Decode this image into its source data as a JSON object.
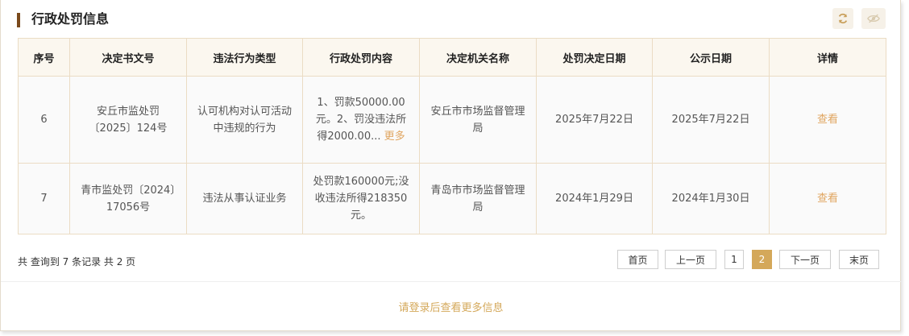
{
  "header": {
    "title": "行政处罚信息",
    "refresh_icon": "refresh-icon",
    "eye_icon": "eye-slash-icon"
  },
  "table": {
    "columns": [
      "序号",
      "决定书文号",
      "违法行为类型",
      "行政处罚内容",
      "决定机关名称",
      "处罚决定日期",
      "公示日期",
      "详情"
    ],
    "rows": [
      {
        "seq": "6",
        "doc_no": "安丘市监处罚〔2025〕124号",
        "violation": "认可机构对认可活动中违规的行为",
        "content": "1、罚款50000.00元。2、罚没违法所得2000.00...",
        "more": "更多",
        "authority": "安丘市市场监督管理局",
        "decision_date": "2025年7月22日",
        "publish_date": "2025年7月22日",
        "detail": "查看"
      },
      {
        "seq": "7",
        "doc_no": "青市监处罚〔2024〕17056号",
        "violation": "违法从事认证业务",
        "content": "处罚款160000元;没收违法所得218350元。",
        "authority": "青岛市市场监督管理局",
        "decision_date": "2024年1月29日",
        "publish_date": "2024年1月30日",
        "detail": "查看"
      }
    ]
  },
  "summary": "共 查询到 7 条记录 共 2 页",
  "pagination": {
    "first": "首页",
    "prev": "上一页",
    "page1": "1",
    "page2": "2",
    "next": "下一页",
    "last": "末页",
    "current": 2
  },
  "login_tip": "请登录后查看更多信息",
  "colors": {
    "accent": "#d4a85a",
    "link": "#e0a560",
    "title_bar": "#7a4a1c",
    "header_bg": "#fbf7ef",
    "border": "#ebdcc4"
  }
}
